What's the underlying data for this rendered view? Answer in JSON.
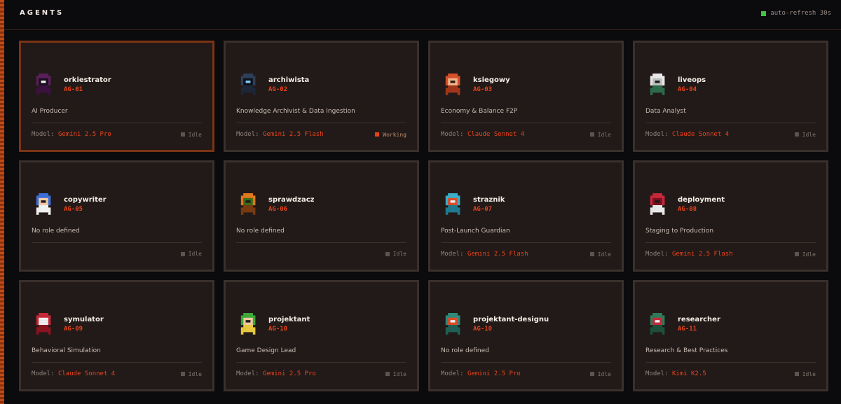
{
  "header": {
    "title": "AGENTS",
    "refresh_label": "auto-refresh 30s",
    "refresh_color": "#3fc43f"
  },
  "labels": {
    "model_prefix": "Model:"
  },
  "agents": [
    {
      "name": "orkiestrator",
      "id": "AG-01",
      "role": "AI Producer",
      "model": "Gemini 2.5 Pro",
      "status": "Idle",
      "avatar": "purple-hood-icon",
      "selected": true
    },
    {
      "name": "archiwista",
      "id": "AG-02",
      "role": "Knowledge Archivist & Data Ingestion",
      "model": "Gemini 2.5 Flash",
      "status": "Working",
      "avatar": "hooded-archivist-icon"
    },
    {
      "name": "ksiegowy",
      "id": "AG-03",
      "role": "Economy & Balance F2P",
      "model": "Claude Sonnet 4",
      "status": "Idle",
      "avatar": "red-dwarf-icon"
    },
    {
      "name": "liveops",
      "id": "AG-04",
      "role": "Data Analyst",
      "model": "Claude Sonnet 4",
      "status": "Idle",
      "avatar": "skeleton-icon"
    },
    {
      "name": "copywriter",
      "id": "AG-05",
      "role": "No role defined",
      "model": "",
      "status": "Idle",
      "avatar": "wizard-icon"
    },
    {
      "name": "sprawdzacz",
      "id": "AG-06",
      "role": "No role defined",
      "model": "",
      "status": "Idle",
      "avatar": "pumpkin-icon"
    },
    {
      "name": "straznik",
      "id": "AG-07",
      "role": "Post-Launch Guardian",
      "model": "Gemini 2.5 Flash",
      "status": "Idle",
      "avatar": "knight-icon"
    },
    {
      "name": "deployment",
      "id": "AG-08",
      "role": "Staging to Production",
      "model": "Gemini 2.5 Flash",
      "status": "Idle",
      "avatar": "red-skeleton-icon"
    },
    {
      "name": "symulator",
      "id": "AG-09",
      "role": "Behavioral Simulation",
      "model": "Claude Sonnet 4",
      "status": "Idle",
      "avatar": "red-demon-icon"
    },
    {
      "name": "projektant",
      "id": "AG-10",
      "role": "Game Design Lead",
      "model": "Gemini 2.5 Pro",
      "status": "Idle",
      "avatar": "elf-icon"
    },
    {
      "name": "projektant-designu",
      "id": "AG-10",
      "role": "No role defined",
      "model": "Gemini 2.5 Pro",
      "status": "Idle",
      "avatar": "lizard-icon"
    },
    {
      "name": "researcher",
      "id": "AG-11",
      "role": "Research & Best Practices",
      "model": "Kimi K2.5",
      "status": "Idle",
      "avatar": "orc-icon"
    }
  ]
}
